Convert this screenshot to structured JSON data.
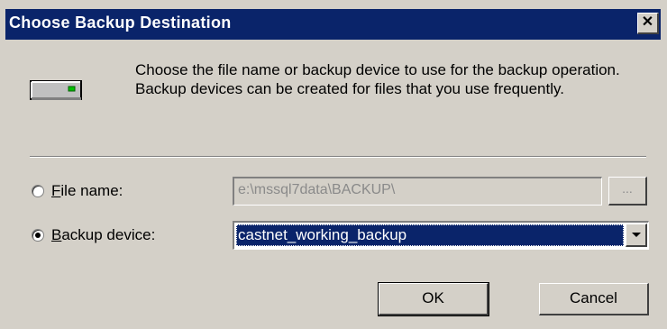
{
  "dialog": {
    "title": "Choose Backup Destination",
    "close_label": "✕"
  },
  "icons": {
    "device": "backup-device-icon",
    "close": "close-icon",
    "dropdown": "chevron-down-icon"
  },
  "description": "Choose the file name or backup device to use for the backup operation.  Backup devices can be created for files that you use frequently.",
  "options": {
    "file_name": {
      "mnemonic": "F",
      "label_rest": "ile name:",
      "value": "e:\\mssql7data\\BACKUP\\",
      "browse_label": "...",
      "selected": false,
      "enabled": false
    },
    "backup_device": {
      "mnemonic": "B",
      "label_rest": "ackup device:",
      "value": "castnet_working_backup",
      "selected": true,
      "enabled": true
    }
  },
  "buttons": {
    "ok": "OK",
    "cancel": "Cancel"
  },
  "colors": {
    "titlebar": "#0a246a",
    "face": "#d4d0c8",
    "selection": "#0a246a"
  }
}
